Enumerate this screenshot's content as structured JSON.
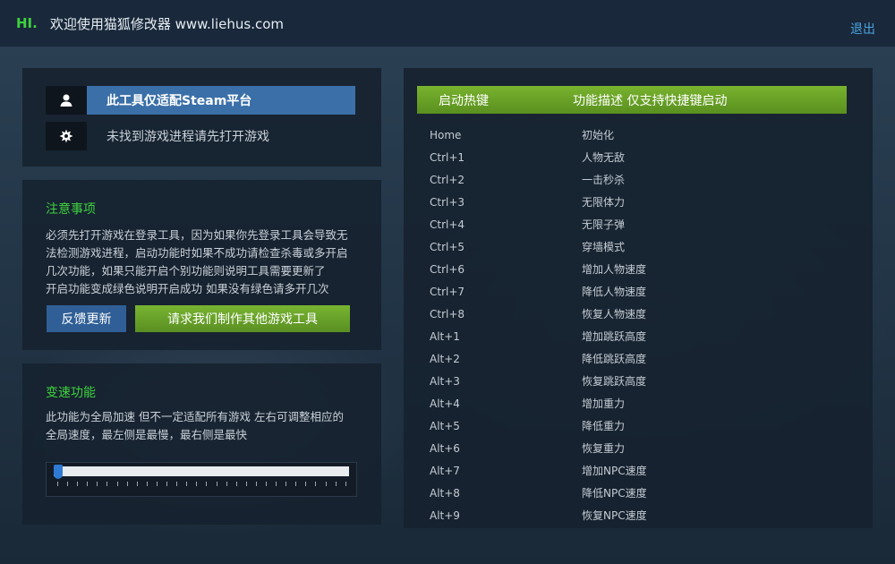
{
  "header": {
    "greeting": "HI.",
    "title": "欢迎使用猫狐修改器 www.liehus.com",
    "logout_label": "退出"
  },
  "status": {
    "platform_text": "此工具仅适配Steam平台",
    "process_text": "未找到游戏进程请先打开游戏",
    "user_icon": "user-icon",
    "gear_icon": "gear-icon"
  },
  "notice": {
    "title": "注意事项",
    "lines": [
      "必须先打开游戏在登录工具，因为如果你先登录工具会导致无",
      "法检测游戏进程，启动功能时如果不成功请检查杀毒或多开启",
      "几次功能，如果只能开启个别功能则说明工具需要更新了",
      "开启功能变成绿色说明开启成功 如果没有绿色请多开几次"
    ],
    "feedback_label": "反馈更新",
    "request_label": "请求我们制作其他游戏工具"
  },
  "speed": {
    "title": "变速功能",
    "lines": [
      "此功能为全局加速 但不一定适配所有游戏 左右可调整相应的",
      "全局速度，最左侧是最慢，最右侧是最快"
    ],
    "value_fraction": 0.0
  },
  "hotkeys": {
    "col_key": "启动热键",
    "col_desc": "功能描述 仅支持快捷键启动",
    "rows": [
      {
        "key": "Home",
        "desc": "初始化"
      },
      {
        "key": "Ctrl+1",
        "desc": "人物无敌"
      },
      {
        "key": "Ctrl+2",
        "desc": "一击秒杀"
      },
      {
        "key": "Ctrl+3",
        "desc": "无限体力"
      },
      {
        "key": "Ctrl+4",
        "desc": "无限子弹"
      },
      {
        "key": "Ctrl+5",
        "desc": "穿墙模式"
      },
      {
        "key": "Ctrl+6",
        "desc": "增加人物速度"
      },
      {
        "key": "Ctrl+7",
        "desc": "降低人物速度"
      },
      {
        "key": "Ctrl+8",
        "desc": "恢复人物速度"
      },
      {
        "key": "Alt+1",
        "desc": "增加跳跃高度"
      },
      {
        "key": "Alt+2",
        "desc": "降低跳跃高度"
      },
      {
        "key": "Alt+3",
        "desc": "恢复跳跃高度"
      },
      {
        "key": "Alt+4",
        "desc": "增加重力"
      },
      {
        "key": "Alt+5",
        "desc": "降低重力"
      },
      {
        "key": "Alt+6",
        "desc": "恢复重力"
      },
      {
        "key": "Alt+7",
        "desc": "增加NPC速度"
      },
      {
        "key": "Alt+8",
        "desc": "降低NPC速度"
      },
      {
        "key": "Alt+9",
        "desc": "恢复NPC速度"
      }
    ]
  },
  "colors": {
    "accent_green": "#3ed13e",
    "button_blue": "#2f5f96",
    "link_blue": "#4aa3e0"
  }
}
